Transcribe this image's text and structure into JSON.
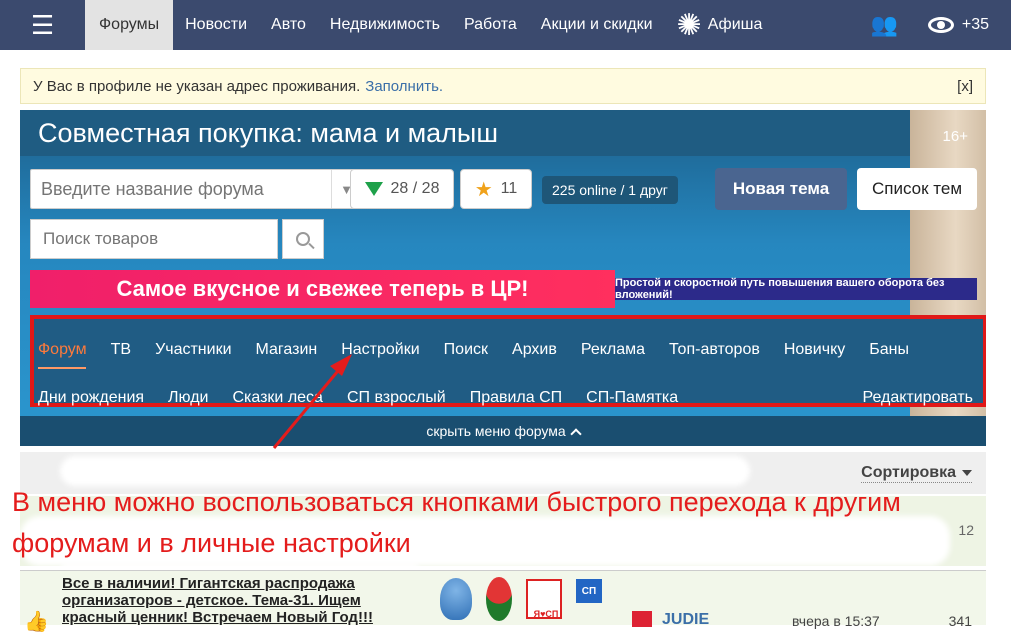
{
  "topnav": {
    "items": [
      {
        "label": "Форумы",
        "active": true
      },
      {
        "label": "Новости"
      },
      {
        "label": "Авто"
      },
      {
        "label": "Недвижимость"
      },
      {
        "label": "Работа"
      },
      {
        "label": "Акции и скидки"
      }
    ],
    "afisha": "Афиша",
    "views": "+35"
  },
  "notice": {
    "text": "У Вас в профиле не указан адрес проживания.",
    "link": "Заполнить.",
    "close": "[x]"
  },
  "banner": {
    "title": "Совместная покупка: мама и малыш",
    "age": "16+",
    "forum_search_placeholder": "Введите название форума",
    "filter_count": "28 / 28",
    "favorites_count": "11",
    "online": "225 online  / 1 друг",
    "new_topic": "Новая тема",
    "topic_list": "Список тем",
    "goods_search_placeholder": "Поиск товаров",
    "promo": "Самое вкусное и свежее теперь в ЦР!",
    "promo2": "Простой и скоростной путь повышения вашего оборота без вложений!",
    "hide_menu": "скрыть меню форума"
  },
  "menu": {
    "row1": [
      "Форум",
      "ТВ",
      "Участники",
      "Магазин",
      "Настройки",
      "Поиск",
      "Архив",
      "Реклама",
      "Топ-авторов",
      "Новичку",
      "Баны"
    ],
    "row2": [
      "Дни рождения",
      "Люди",
      "Сказки леса",
      "СП взрослый",
      "Правила СП",
      "СП-Памятка"
    ],
    "edit": "Редактировать"
  },
  "list": {
    "sort": "Сортировка",
    "annotation": "В меню можно воспользоваться кнопками быстрого перехода к другим форумам и в личные настройки",
    "subhead_num": "12",
    "topic": {
      "title": "Все в наличии! Гигантская распродажа организаторов - детское. Тема-31. Ищем красный ценник! Встречаем Новый Год!!!",
      "sp_label": "СП",
      "author": "JUDIE",
      "date": "вчера в 15:37",
      "count": "341"
    }
  },
  "colors": {
    "nav_bg": "#3b4a6e",
    "menu_border": "#e01818",
    "annotation": "#e41c1c"
  }
}
